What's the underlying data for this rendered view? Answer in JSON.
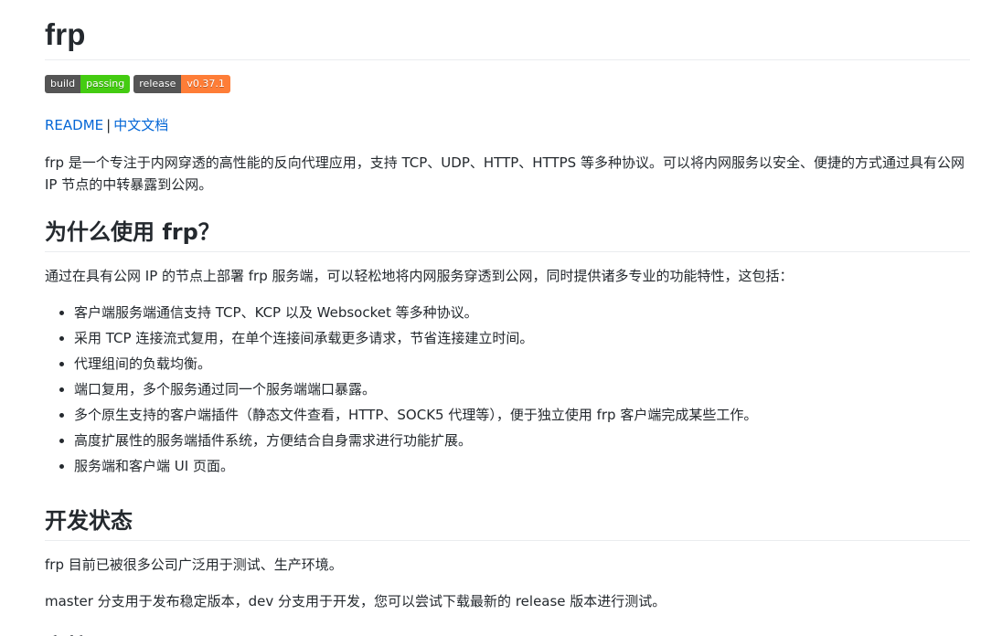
{
  "title": "frp",
  "badges": [
    {
      "left": "build",
      "right": "passing",
      "color": "#44cc11"
    },
    {
      "left": "release",
      "right": "v0.37.1",
      "color": "#fe7d37"
    }
  ],
  "links": {
    "readme": "README",
    "separator": "|",
    "chinese_docs": "中文文档"
  },
  "intro": "frp 是一个专注于内网穿透的高性能的反向代理应用，支持 TCP、UDP、HTTP、HTTPS 等多种协议。可以将内网服务以安全、便捷的方式通过具有公网 IP 节点的中转暴露到公网。",
  "why": {
    "heading": "为什么使用 frp？",
    "intro": "通过在具有公网 IP 的节点上部署 frp 服务端，可以轻松地将内网服务穿透到公网，同时提供诸多专业的功能特性，这包括：",
    "items": [
      "客户端服务端通信支持 TCP、KCP 以及 Websocket 等多种协议。",
      "采用 TCP 连接流式复用，在单个连接间承载更多请求，节省连接建立时间。",
      "代理组间的负载均衡。",
      "端口复用，多个服务通过同一个服务端端口暴露。",
      "多个原生支持的客户端插件（静态文件查看，HTTP、SOCK5 代理等），便于独立使用 frp 客户端完成某些工作。",
      "高度扩展性的服务端插件系统，方便结合自身需求进行功能扩展。",
      "服务端和客户端 UI 页面。"
    ]
  },
  "status": {
    "heading": "开发状态",
    "p1": "frp 目前已被很多公司广泛用于测试、生产环境。",
    "p2": "master 分支用于发布稳定版本，dev 分支用于开发，您可以尝试下载最新的 release 版本进行测试。"
  },
  "next_heading": "文档"
}
